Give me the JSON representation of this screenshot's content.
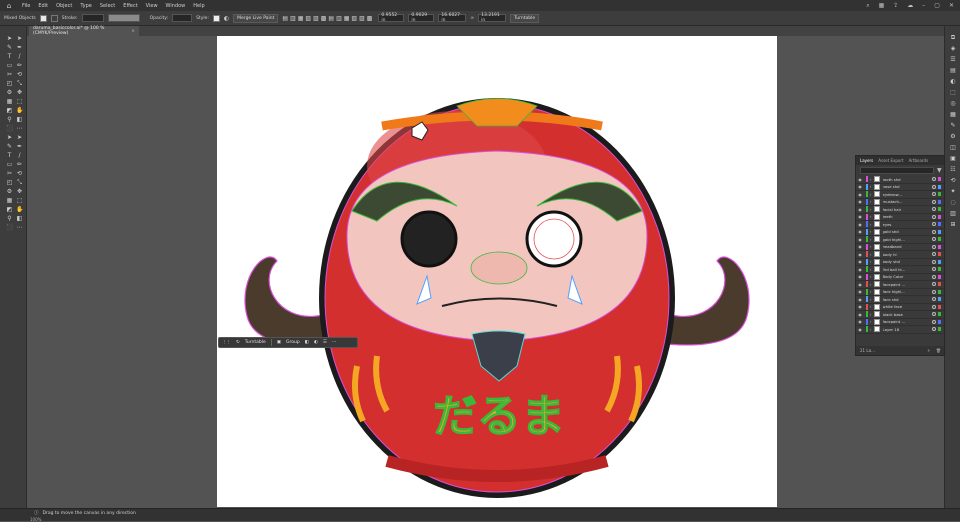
{
  "menu": {
    "items": [
      "File",
      "Edit",
      "Object",
      "Type",
      "Select",
      "Effect",
      "View",
      "Window",
      "Help"
    ]
  },
  "control_bar": {
    "selection_label": "Mixed Objects",
    "stroke_label": "Stroke:",
    "opacity_label": "Opacity:",
    "style_label": "Style:",
    "merge_button": "Merge Live Paint",
    "x_value": "0.9552 in",
    "y_value": "0.9029 in",
    "w_value": "16.6027 in",
    "h_value": "13.2191 in",
    "turntable_button": "Turntable"
  },
  "document_tab": {
    "title": "daruma_basiccolor.ai* @ 100 % (CMYK/Preview)",
    "close": "×"
  },
  "context_bar": {
    "turntable": "Turntable",
    "group": "Group",
    "more": "···"
  },
  "layers_panel": {
    "tabs": [
      "Layers",
      "Asset Export",
      "Artboards"
    ],
    "layers": [
      {
        "name": "tooth shd",
        "color": "#d94fd9"
      },
      {
        "name": "nose shd",
        "color": "#4fa0ff"
      },
      {
        "name": "eyebrow...",
        "color": "#3ab83a"
      },
      {
        "name": "mustach...",
        "color": "#4f6fff"
      },
      {
        "name": "facial hair",
        "color": "#3ab83a"
      },
      {
        "name": "teeth",
        "color": "#d94fd9"
      },
      {
        "name": "eyes",
        "color": "#4f6fff"
      },
      {
        "name": "gold shd",
        "color": "#4fa0ff"
      },
      {
        "name": "gold highl...",
        "color": "#3ab83a"
      },
      {
        "name": "headband",
        "color": "#d94fd9"
      },
      {
        "name": "body hl",
        "color": "#e64f4f"
      },
      {
        "name": "body shd",
        "color": "#4fa0ff"
      },
      {
        "name": "3rd ball hi...",
        "color": "#3ab83a"
      },
      {
        "name": "Body Color",
        "color": "#d94fd9"
      },
      {
        "name": "facepaint ...",
        "color": "#e64f4f"
      },
      {
        "name": "face highl...",
        "color": "#3ab83a"
      },
      {
        "name": "face shd",
        "color": "#4fa0ff"
      },
      {
        "name": "white face",
        "color": "#e64f4f"
      },
      {
        "name": "black base",
        "color": "#3ab83a"
      },
      {
        "name": "facepaint ...",
        "color": "#4f6fff"
      },
      {
        "name": "Layer 16",
        "color": "#3ab83a"
      }
    ],
    "footer_count": "21 La..."
  },
  "status": {
    "zoom": "100%",
    "hint": "Drag to move the canvas in any direction"
  },
  "artwork": {
    "face_lettering": "だるま"
  }
}
